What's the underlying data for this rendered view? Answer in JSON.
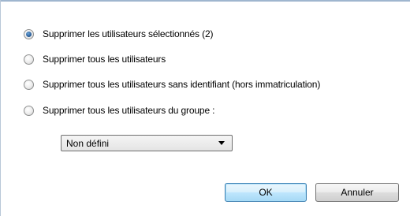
{
  "options": [
    {
      "label": "Supprimer les utilisateurs sélectionnés (2)",
      "checked": true
    },
    {
      "label": "Supprimer tous les utilisateurs",
      "checked": false
    },
    {
      "label": "Supprimer tous les utilisateurs sans identifiant (hors immatriculation)",
      "checked": false
    },
    {
      "label": "Supprimer tous les utilisateurs du groupe :",
      "checked": false
    }
  ],
  "group_select": {
    "value": "Non défini"
  },
  "buttons": {
    "ok": "OK",
    "cancel": "Annuler"
  },
  "colors": {
    "accent": "#24558f",
    "ok_button": "#bee6fd"
  }
}
